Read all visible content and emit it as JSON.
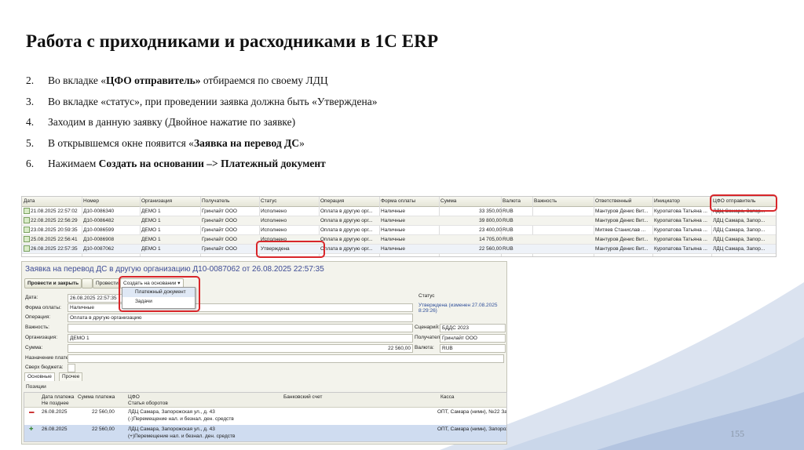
{
  "title": "Работа с приходниками и расходниками в 1С ERP",
  "steps": [
    {
      "num": "2.",
      "pre": "Во вкладке «",
      "bold": "ЦФО отправитель»",
      "post": " отбираемся по своему ЛДЦ"
    },
    {
      "num": "3.",
      "pre": "Во вкладке «статус», при проведении заявка должна быть «Утверждена»",
      "bold": "",
      "post": ""
    },
    {
      "num": "4.",
      "pre": "Заходим в данную заявку (Двойное нажатие по заявке)",
      "bold": "",
      "post": ""
    },
    {
      "num": "5.",
      "pre": "В открывшемся окне появится «",
      "bold": "Заявка на перевод ДС",
      "post": "»"
    },
    {
      "num": "6.",
      "pre": "Нажимаем ",
      "bold": "Создать на основании –> Платежный документ",
      "post": ""
    }
  ],
  "page_number": "155",
  "grid": {
    "columns": [
      "Дата",
      "Номер",
      "Организация",
      "Получатель",
      "Статус",
      "Операция",
      "Форма оплаты",
      "Сумма",
      "Валюта",
      "Важность",
      "Ответственный",
      "Инициатор",
      "ЦФО отправитель"
    ],
    "rows": [
      [
        "21.08.2025 22:57:02",
        "Д10-0086340",
        "ДЕМО 1",
        "Гринлайт ООО",
        "Исполнено",
        "Оплата в другую орг...",
        "Наличные",
        "33 350,00",
        "RUB",
        "",
        "Мантуров Денис Вит...",
        "Куропатова Татьяна ...",
        "ЛДЦ Самара, Запор..."
      ],
      [
        "22.08.2025 22:56:29",
        "Д10-0086482",
        "ДЕМО 1",
        "Гринлайт ООО",
        "Исполнено",
        "Оплата в другую орг...",
        "Наличные",
        "39 800,00",
        "RUB",
        "",
        "Мантуров Денис Вит...",
        "Куропатова Татьяна ...",
        "ЛДЦ Самара, Запор..."
      ],
      [
        "23.08.2025 20:59:35",
        "Д10-0086599",
        "ДЕМО 1",
        "Гринлайт ООО",
        "Исполнено",
        "Оплата в другую орг...",
        "Наличные",
        "23 400,00",
        "RUB",
        "",
        "Митяев Станислав ...",
        "Куропатова Татьяна ...",
        "ЛДЦ Самара, Запор..."
      ],
      [
        "25.08.2025 22:56:41",
        "Д10-0086908",
        "ДЕМО 1",
        "Гринлайт ООО",
        "Исполнено",
        "Оплата в другую орг...",
        "Наличные",
        "14 705,00",
        "RUB",
        "",
        "Мантуров Денис Вит...",
        "Куропатова Татьяна ...",
        "ЛДЦ Самара, Запор..."
      ],
      [
        "26.08.2025 22:57:35",
        "Д10-0087062",
        "ДЕМО 1",
        "Гринлайт ООО",
        "Утверждена",
        "Оплата в другую орг...",
        "Наличные",
        "22 560,00",
        "RUB",
        "",
        "Мантуров Денис Вит...",
        "Куропатова Татьяна ...",
        "ЛДЦ Самара, Запор..."
      ]
    ]
  },
  "form": {
    "title": "Заявка на перевод ДС в другую организацию Д10-0087062 от 26.08.2025 22:57:35",
    "btn_post_close": "Провести и закрыть",
    "btn_post": "Провести",
    "btn_create_based": "Создать на основании",
    "dropdown": [
      "Платежный документ",
      "Задачи"
    ],
    "labels": {
      "date": "Дата:",
      "payment_form": "Форма оплаты:",
      "operation": "Операция:",
      "importance": "Важность:",
      "organization": "Организация:",
      "sum": "Сумма:",
      "purpose": "Назначение платежа:",
      "over_budget": "Сверх бюджета:",
      "status_group": "Статус",
      "scenario": "Сценарий:",
      "recipient": "Получатель:",
      "currency": "Валюта:"
    },
    "values": {
      "date": "26.08.2025 22:57:35",
      "payment_form": "Наличные",
      "operation": "Оплата в другую организацию",
      "organization": "ДЕМО 1",
      "sum": "22 560,00",
      "status": "Утверждена (изменен 27.08.2025 8:29:26)",
      "scenario": "БДДС 2023",
      "recipient": "Гринлайт ООО",
      "currency": "RUB"
    },
    "tabs": [
      "Основные",
      "Прочее"
    ],
    "positions_label": "Позиции",
    "sub_columns": [
      "Дата платежа",
      "Сумма платежа",
      "ЦФО",
      "Банковский счет",
      "Касса"
    ],
    "sub_subcolumns": [
      "Не позднее",
      "Статья оборотов"
    ],
    "sub_rows": [
      {
        "date": "26.08.2025",
        "sum": "22 560,00",
        "cfo": "ЛДЦ Самара, Запорожская ул., д. 43",
        "article": "(-)Перемещение нал. и безнал. ден. средств",
        "kassa": "ОПТ, Самара (нимн), №22 Запорож"
      },
      {
        "date": "26.08.2025",
        "sum": "22 560,00",
        "cfo": "ЛДЦ Самара, Запорожская ул., д. 43",
        "article": "(+)Перемещение нал. и безнал. ден. средств",
        "kassa": "ОПТ, Самара (нимн), Запорожская"
      }
    ]
  },
  "colors": {
    "highlight": "#d8262a",
    "form_title": "#3d4b94",
    "background_wave": "#b7c6df"
  }
}
